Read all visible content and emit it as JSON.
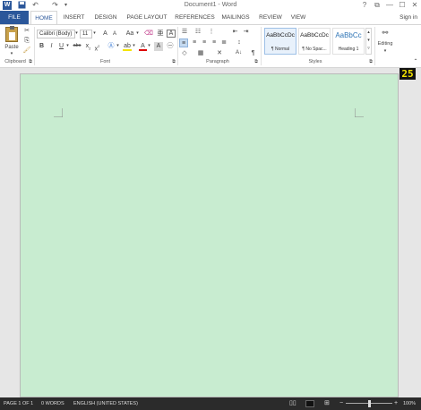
{
  "title": "Document1 - Word",
  "window_controls": {
    "help": "?",
    "restore": "⧉",
    "minimize": "—",
    "maximize": "☐",
    "close": "✕"
  },
  "quick_access": {
    "undo": "↶",
    "redo": "↷"
  },
  "tabs": [
    "FILE",
    "HOME",
    "INSERT",
    "DESIGN",
    "PAGE LAYOUT",
    "REFERENCES",
    "MAILINGS",
    "REVIEW",
    "VIEW"
  ],
  "sign_in": "Sign in",
  "clipboard": {
    "paste_label": "Paste",
    "group_label": "Clipboard"
  },
  "font": {
    "family": "Calibri (Body)",
    "size": "11",
    "grow": "A",
    "shrink": "A",
    "case": "Aa",
    "bold": "B",
    "italic": "I",
    "underline": "U",
    "strike": "abc",
    "subscript": "x",
    "superscript": "x",
    "font_color": "A",
    "group_label": "Font"
  },
  "paragraph": {
    "sort": "A↓",
    "pilcrow": "¶",
    "group_label": "Paragraph"
  },
  "styles": {
    "items": [
      {
        "preview": "AaBbCcDc",
        "name": "¶ Normal"
      },
      {
        "preview": "AaBbCcDc",
        "name": "¶ No Spac..."
      },
      {
        "preview": "AaBbCc",
        "name": "Heading 1"
      }
    ],
    "group_label": "Styles"
  },
  "editing": {
    "label": "Editing"
  },
  "badge": "25",
  "status": {
    "page": "PAGE 1 OF 1",
    "words": "0 WORDS",
    "language": "ENGLISH (UNITED STATES)",
    "zoom": "100%",
    "zoom_out": "−",
    "zoom_in": "+",
    "zoom_level": 0.5
  },
  "colors": {
    "accent": "#2b579a",
    "page": "#c8ecd0",
    "status_bar": "#2b2b2b",
    "badge_text": "#f6e400"
  }
}
